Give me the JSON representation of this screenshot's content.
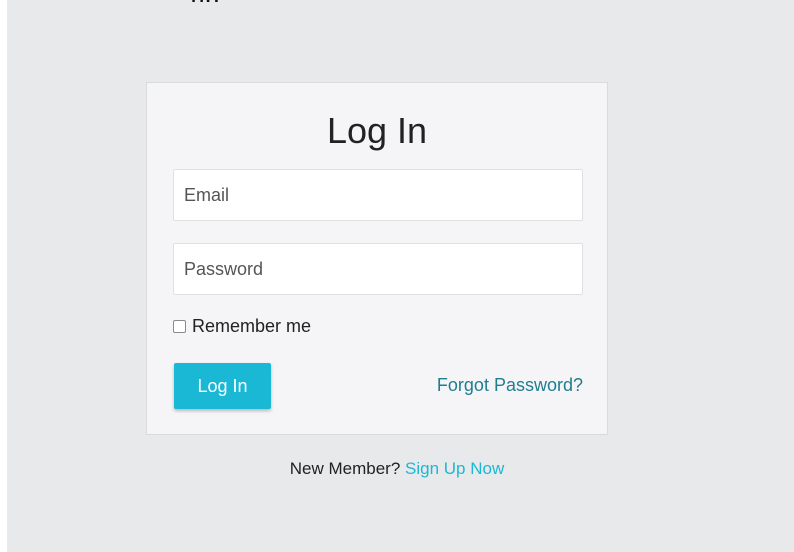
{
  "top_fragment": "ng",
  "login": {
    "title": "Log In",
    "email_placeholder": "Email",
    "password_placeholder": "Password",
    "remember_label": "Remember me",
    "submit_label": "Log In",
    "forgot_label": "Forgot Password?"
  },
  "signup": {
    "prompt": "New Member?",
    "link_label": "Sign Up Now"
  },
  "colors": {
    "background": "#e8e9ea",
    "card": "#f5f5f7",
    "accent": "#1bb8d6",
    "link": "#1f7e8f"
  }
}
